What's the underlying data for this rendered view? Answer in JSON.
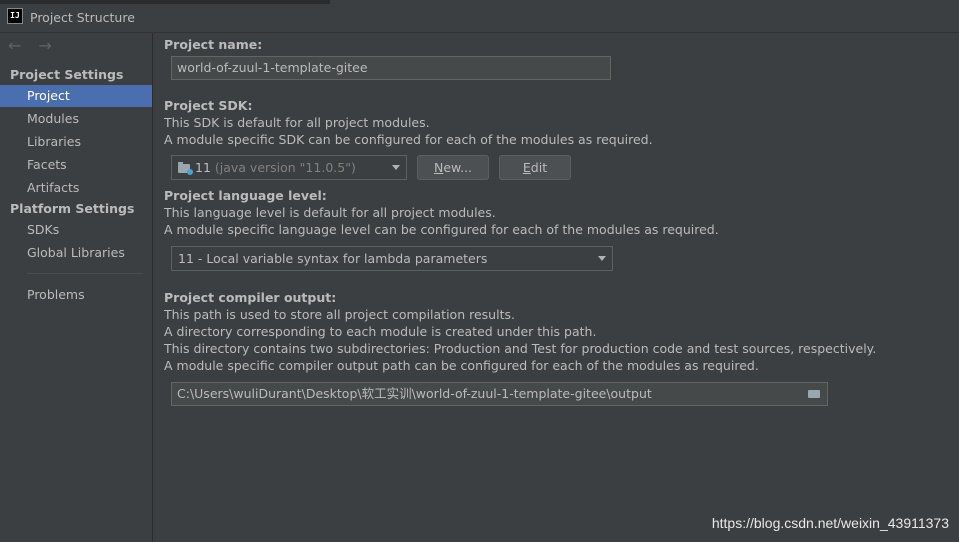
{
  "window": {
    "title": "Project Structure",
    "app_icon_text": "IJ"
  },
  "sidebar": {
    "nav_arrows": "← →",
    "project_settings_head": "Project Settings",
    "project_settings_items": [
      "Project",
      "Modules",
      "Libraries",
      "Facets",
      "Artifacts"
    ],
    "selected": "Project",
    "platform_settings_head": "Platform Settings",
    "platform_settings_items": [
      "SDKs",
      "Global Libraries"
    ],
    "problems": "Problems"
  },
  "project_name": {
    "label": "Project name:",
    "value": "world-of-zuul-1-template-gitee"
  },
  "project_sdk": {
    "label": "Project SDK:",
    "desc1": "This SDK is default for all project modules.",
    "desc2": "A module specific SDK can be configured for each of the modules as required.",
    "selected_version": "11",
    "selected_detail": "(java version \"11.0.5\")",
    "new_button_mnemonic": "N",
    "new_button_rest": "ew...",
    "edit_button_mnemonic": "E",
    "edit_button_rest": "dit"
  },
  "language_level": {
    "label": "Project language level:",
    "desc1": "This language level is default for all project modules.",
    "desc2": "A module specific language level can be configured for each of the modules as required.",
    "selected": "11 - Local variable syntax for lambda parameters"
  },
  "compiler_output": {
    "label": "Project compiler output:",
    "desc1": "This path is used to store all project compilation results.",
    "desc2": "A directory corresponding to each module is created under this path.",
    "desc3": "This directory contains two subdirectories: Production and Test for production code and test sources, respectively.",
    "desc4": "A module specific compiler output path can be configured for each of the modules as required.",
    "path": "C:\\Users\\wuliDurant\\Desktop\\软工实训\\world-of-zuul-1-template-gitee\\output"
  },
  "watermark": "https://blog.csdn.net/weixin_43911373",
  "colors": {
    "background": "#3c3f41",
    "selection": "#4b6eaf",
    "text": "#bbbbbb"
  }
}
